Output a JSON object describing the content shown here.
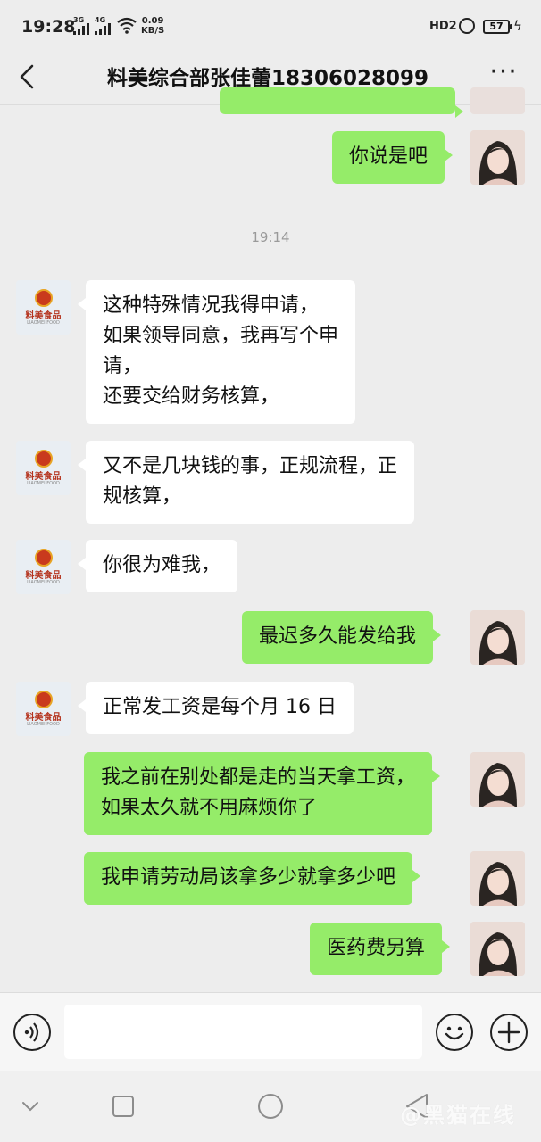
{
  "status_bar": {
    "time": "19:28",
    "signal_1_label": "3G",
    "signal_2_label": "4G",
    "net_speed_value": "0.09",
    "net_speed_unit": "KB/S",
    "hd_label": "HD2",
    "battery_level": "57"
  },
  "header": {
    "title": "料美综合部张佳蕾18306028099",
    "back_icon": "chevron-left-icon",
    "more_icon": "more-dots-icon",
    "more_label": "···"
  },
  "messages": {
    "m0": {
      "side": "out",
      "lines": [
        "你说是吧"
      ]
    },
    "ts1": "19:14",
    "m1": {
      "side": "in",
      "lines": [
        "这种特殊情况我得申请，",
        "如果领导同意，我再写个申",
        "请，",
        "还要交给财务核算，"
      ]
    },
    "m2": {
      "side": "in",
      "lines": [
        "又不是几块钱的事，正规流程，正",
        "规核算，"
      ]
    },
    "m3": {
      "side": "in",
      "lines": [
        "你很为难我，"
      ]
    },
    "m4": {
      "side": "out",
      "lines": [
        "最迟多久能发给我"
      ]
    },
    "m5": {
      "side": "in",
      "lines": [
        "正常发工资是每个月 16 日"
      ]
    },
    "m6": {
      "side": "out",
      "lines": [
        "我之前在别处都是走的当天拿工资，",
        "如果太久就不用麻烦你了"
      ]
    },
    "m7": {
      "side": "out",
      "lines": [
        "我申请劳动局该拿多少就拿多少吧"
      ]
    },
    "m8": {
      "side": "out",
      "lines": [
        "医药费另算"
      ]
    }
  },
  "contact_avatar": {
    "brand": "料美食品",
    "brand_sub": "LIAOMEI FOOD"
  },
  "input_bar": {
    "voice_icon": "voice-icon",
    "emoji_icon": "emoji-icon",
    "plus_icon": "plus-icon",
    "input_value": ""
  },
  "system_nav": {
    "watermark": "@黑猫在线",
    "icons": [
      "nav-down-icon",
      "nav-recent-icon",
      "nav-home-icon",
      "nav-back-icon"
    ]
  },
  "colors": {
    "background": "#ededed",
    "incoming_bubble": "#ffffff",
    "outgoing_bubble": "#95ec69",
    "brand_red": "#c93a1d"
  }
}
